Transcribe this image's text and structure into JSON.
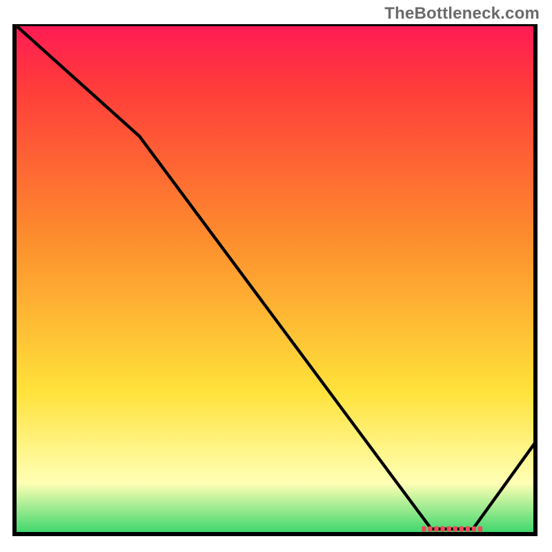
{
  "watermark": "TheBottleneck.com",
  "colors": {
    "gradient_top": "#ff1a55",
    "gradient_mid_red": "#ff3b3b",
    "gradient_orange": "#fd8d2d",
    "gradient_yellow": "#ffe23a",
    "gradient_paleyellow": "#ffffb5",
    "gradient_green": "#38d66a",
    "frame": "#000000",
    "curve": "#000000",
    "marker": "#ef4957"
  },
  "chart_data": {
    "type": "line",
    "title": "",
    "xlabel": "",
    "ylabel": "",
    "xlim": [
      0,
      100
    ],
    "ylim": [
      0,
      100
    ],
    "x": [
      0,
      24,
      80,
      88,
      100
    ],
    "values": [
      100,
      78,
      1,
      1,
      18
    ],
    "annotations": [
      {
        "kind": "marker-band",
        "x_start": 78,
        "x_end": 90,
        "y": 1
      }
    ]
  }
}
